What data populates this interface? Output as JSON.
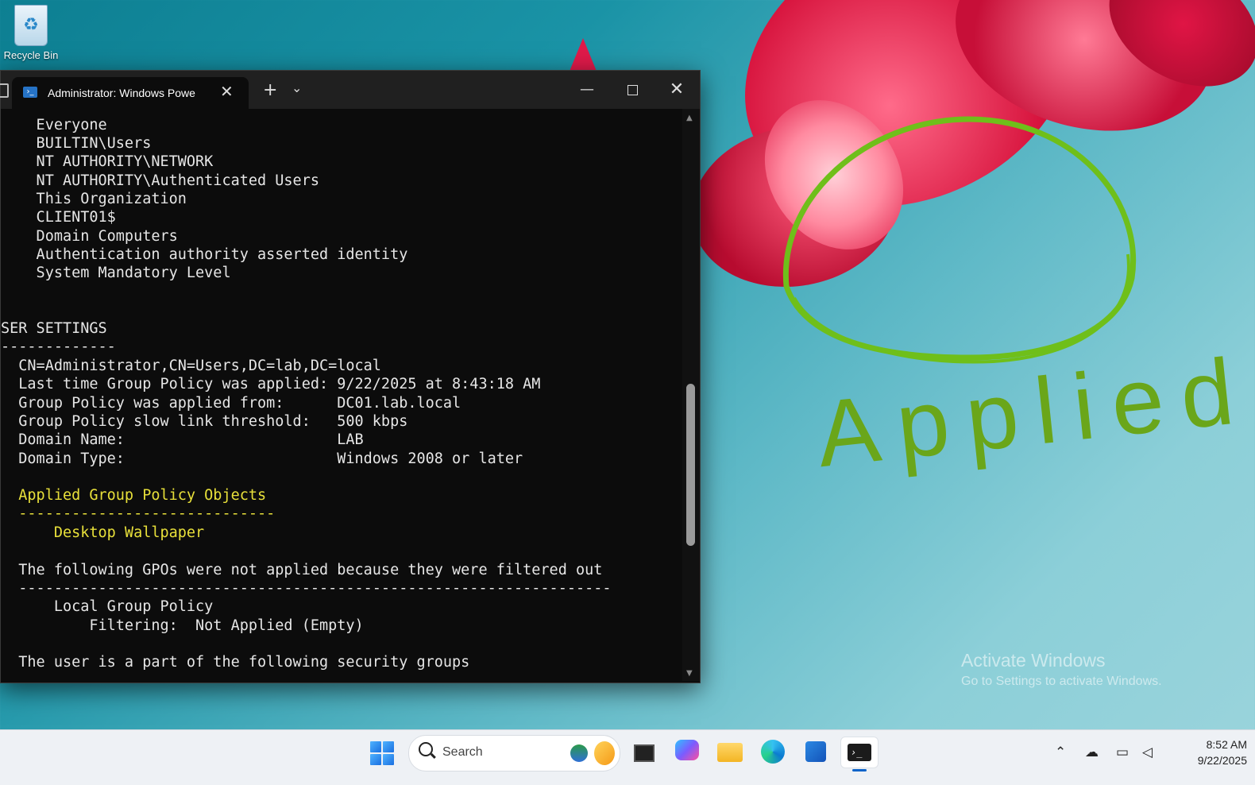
{
  "desktop": {
    "recycle_bin_label": "Recycle Bin",
    "annotation_text": "Applied",
    "watermark_title": "Activate Windows",
    "watermark_sub": "Go to Settings to activate Windows."
  },
  "window": {
    "tab_title": "Administrator: Windows Powe",
    "new_tab_symbol": "+",
    "dropdown_symbol": "⌄",
    "minimize_symbol": "—",
    "close_symbol": "✕"
  },
  "console": {
    "lines": [
      "    Everyone",
      "    BUILTIN\\Users",
      "    NT AUTHORITY\\NETWORK",
      "    NT AUTHORITY\\Authenticated Users",
      "    This Organization",
      "    CLIENT01$",
      "    Domain Computers",
      "    Authentication authority asserted identity",
      "    System Mandatory Level",
      "",
      "",
      "SER SETTINGS",
      "-------------",
      "  CN=Administrator,CN=Users,DC=lab,DC=local",
      "  Last time Group Policy was applied: 9/22/2025 at 8:43:18 AM",
      "  Group Policy was applied from:      DC01.lab.local",
      "  Group Policy slow link threshold:   500 kbps",
      "  Domain Name:                        LAB",
      "  Domain Type:                        Windows 2008 or later",
      "",
      "  Applied Group Policy Objects",
      "  -----------------------------",
      "      Desktop Wallpaper",
      "",
      "  The following GPOs were not applied because they were filtered out",
      "  -------------------------------------------------------------------",
      "      Local Group Policy",
      "          Filtering:  Not Applied (Empty)",
      "",
      "  The user is a part of the following security groups"
    ]
  },
  "taskbar": {
    "search_placeholder": "Search",
    "time": "8:52 AM",
    "date": "9/22/2025"
  }
}
